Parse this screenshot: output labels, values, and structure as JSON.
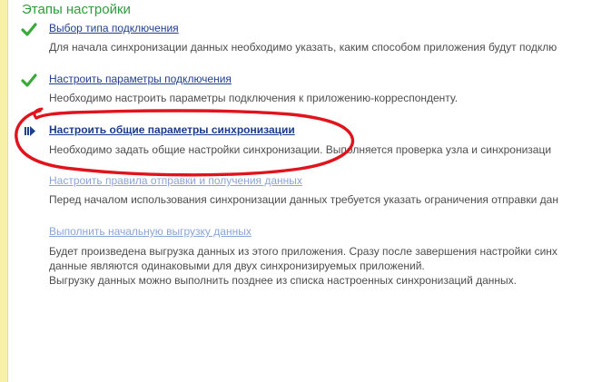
{
  "section_title": "Этапы настройки",
  "steps": [
    {
      "status": "done",
      "icon": "checkmark-icon",
      "label": "Выбор типа подключения",
      "description": "Для начала синхронизации данных необходимо указать, каким способом приложения будут подклю"
    },
    {
      "status": "done",
      "icon": "checkmark-icon",
      "label": "Настроить параметры подключения",
      "description": "Необходимо настроить параметры подключения к приложению-корреспонденту."
    },
    {
      "status": "current",
      "icon": "current-step-arrow-icon",
      "label": "Настроить общие параметры синхронизации",
      "description": "Необходимо задать общие настройки синхронизации. Выполняется проверка узла и синхронизаци"
    },
    {
      "status": "pending",
      "icon": "",
      "label": "Настроить правила отправки и получения данных",
      "description": "Перед началом использования синхронизации данных требуется указать ограничения отправки дан"
    },
    {
      "status": "pending",
      "icon": "",
      "label": "Выполнить начальную выгрузку данных",
      "description_lines": [
        "Будет произведена выгрузка данных из этого приложения. Сразу после завершения настройки синх",
        "данные являются одинаковыми для двух синхронизируемых приложений.",
        "Выгрузку данных можно выполнить позднее из списка настроенных синхронизаций данных."
      ]
    }
  ],
  "colors": {
    "title_green": "#2f9d3a",
    "check_green": "#3aaa3a",
    "link_blue": "#1f3f8f",
    "link_pending": "#8aa6d6",
    "annotation_red": "#e0141c",
    "left_strip": "#f7f1a8"
  }
}
